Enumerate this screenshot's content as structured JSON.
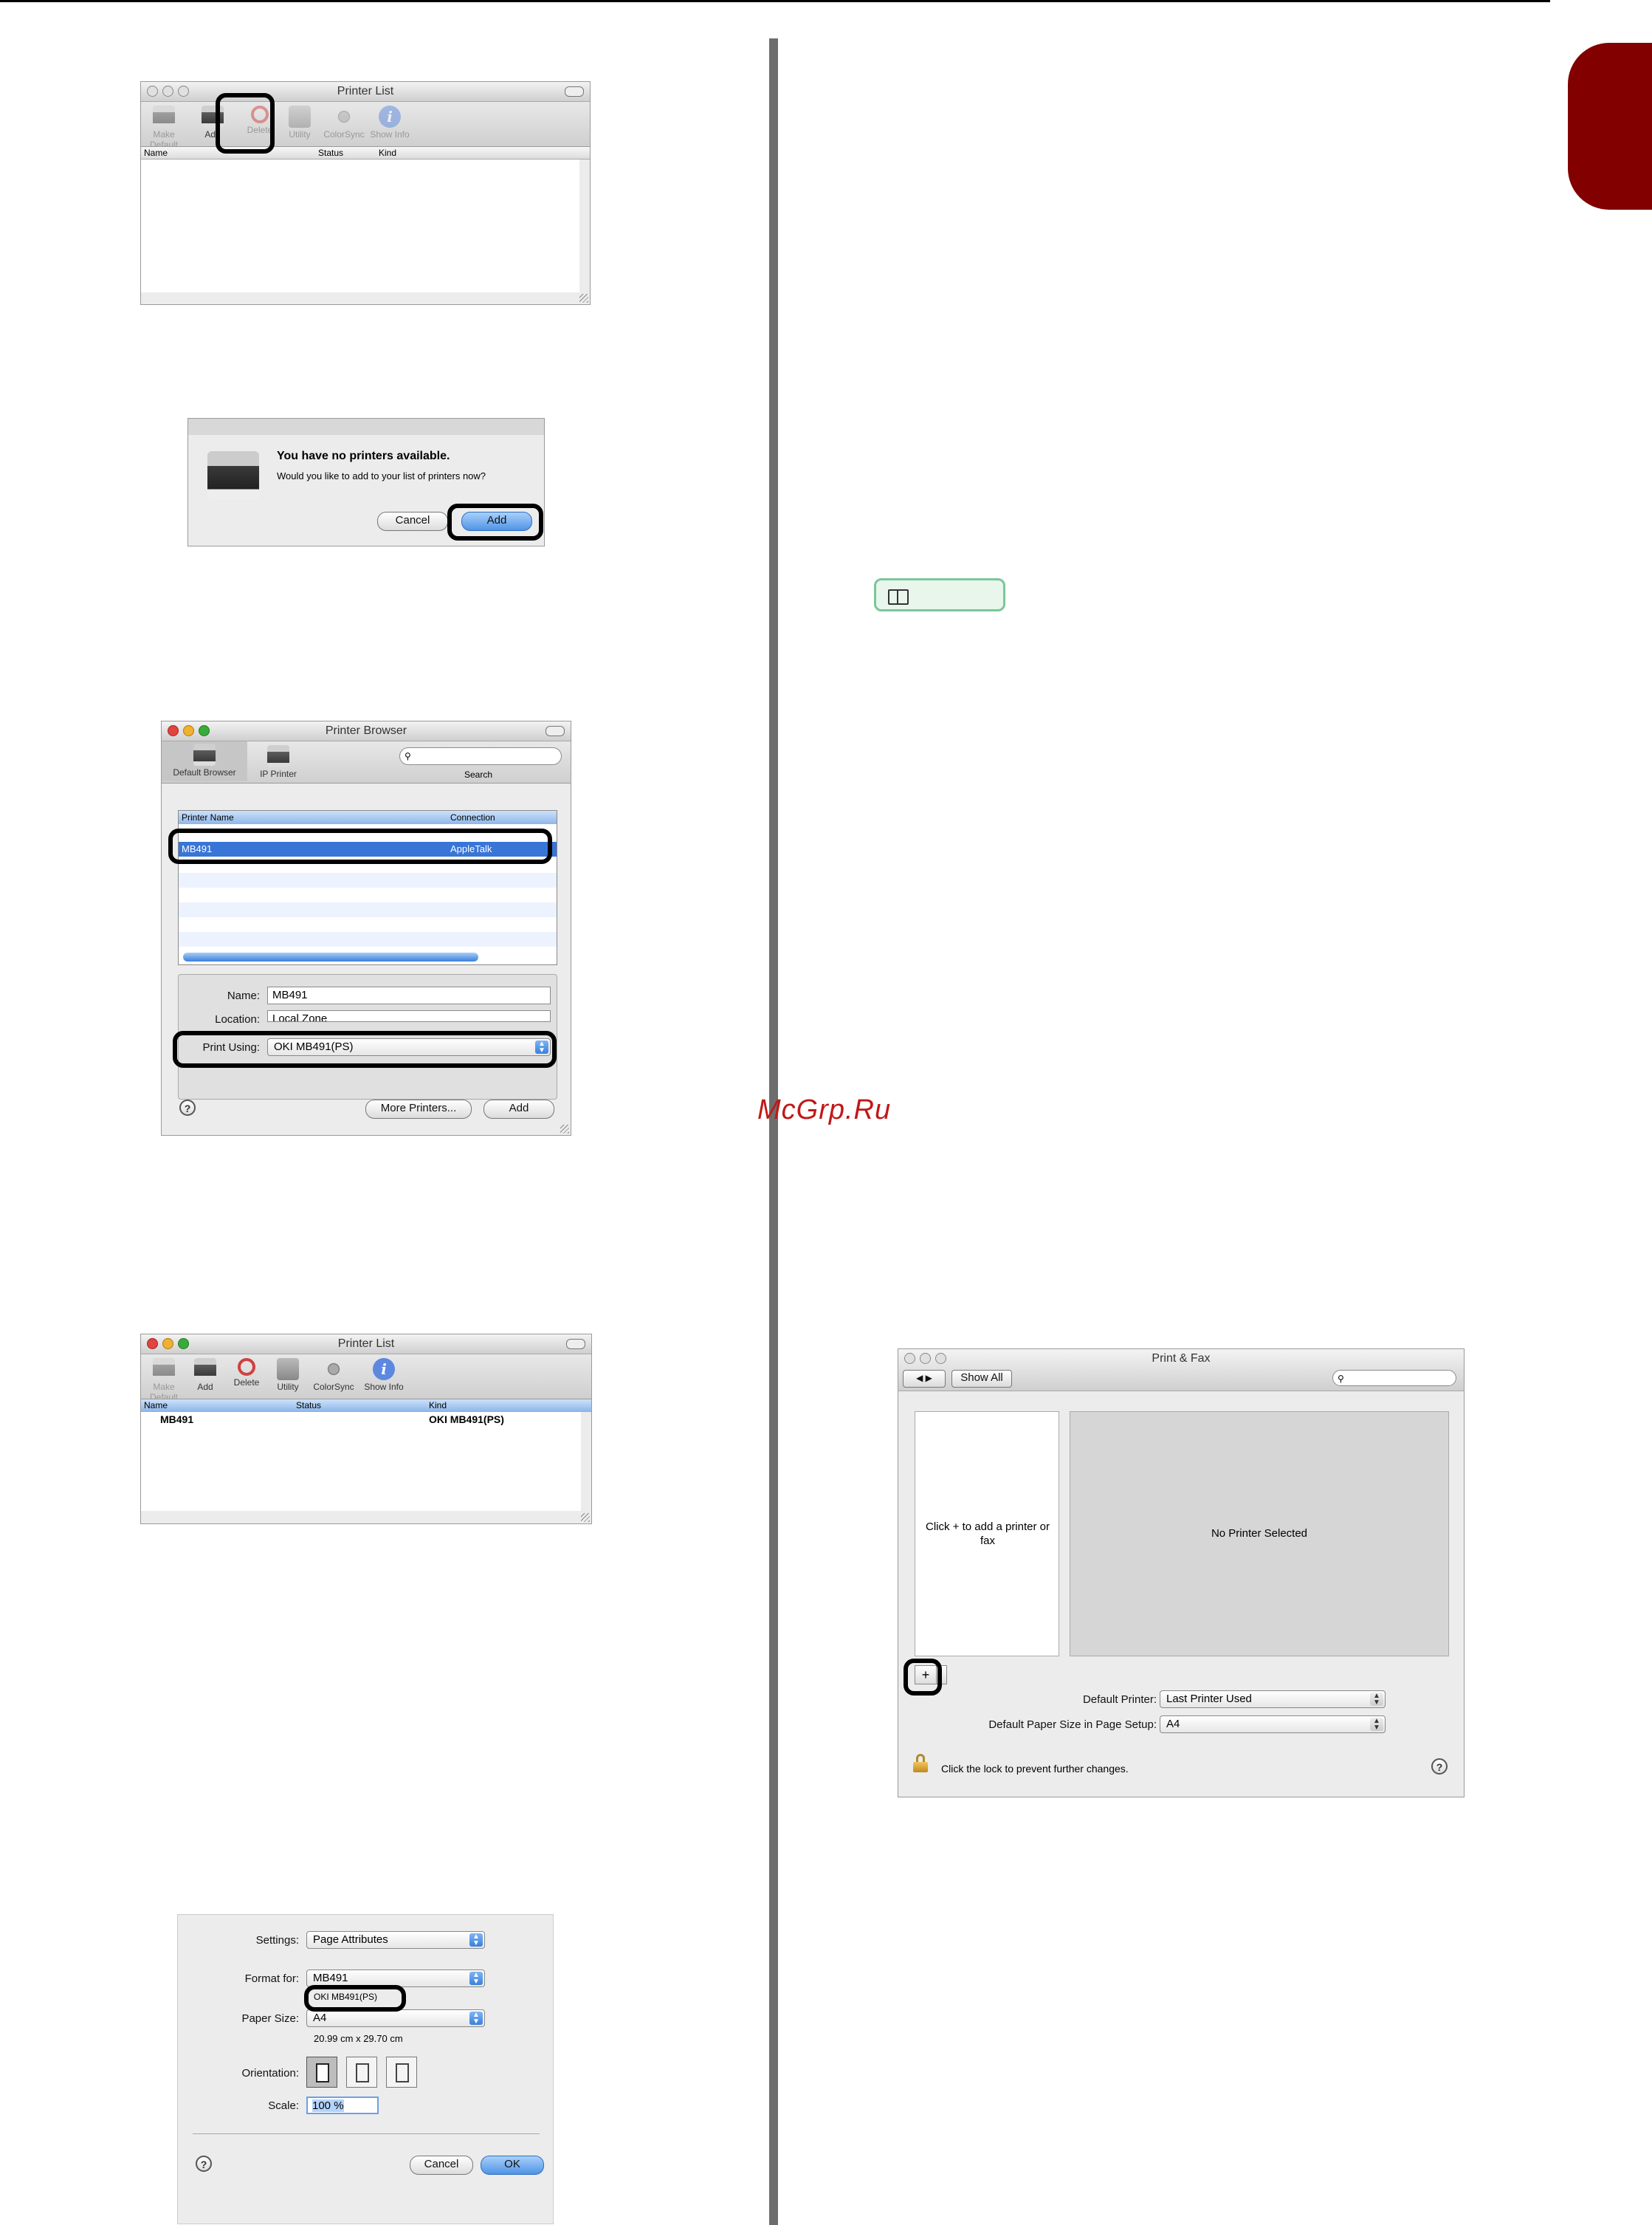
{
  "watermark": "McGrp.Ru",
  "printer_list_empty": {
    "title": "Printer List",
    "toolbar": [
      "Make Default",
      "Add",
      "Delete",
      "Utility",
      "ColorSync",
      "Show Info"
    ],
    "columns": [
      "Name",
      "Status",
      "Kind"
    ]
  },
  "no_printers_dialog": {
    "heading": "You have no printers available.",
    "message": "Would you like to add to your list of printers now?",
    "cancel": "Cancel",
    "add": "Add"
  },
  "printer_browser": {
    "title": "Printer Browser",
    "tabs": [
      "Default Browser",
      "IP Printer"
    ],
    "search_label": "Search",
    "columns": [
      "Printer Name",
      "Connection"
    ],
    "selected_row": {
      "name": "MB491",
      "connection": "AppleTalk"
    },
    "name_label": "Name:",
    "name_value": "MB491",
    "location_label": "Location:",
    "location_value": "Local Zone",
    "print_using_label": "Print Using:",
    "print_using_value": "OKI MB491(PS)",
    "more_printers": "More Printers...",
    "add": "Add",
    "help": "?"
  },
  "printer_list_added": {
    "title": "Printer List",
    "toolbar": [
      "Make Default",
      "Add",
      "Delete",
      "Utility",
      "ColorSync",
      "Show Info"
    ],
    "columns": [
      "Name",
      "Status",
      "Kind"
    ],
    "row": {
      "name": "MB491",
      "kind": "OKI MB491(PS)"
    }
  },
  "page_setup": {
    "settings_label": "Settings:",
    "settings_value": "Page Attributes",
    "format_label": "Format for:",
    "format_value": "MB491",
    "format_sub": "OKI MB491(PS)",
    "paper_label": "Paper Size:",
    "paper_value": "A4",
    "paper_sub": "20.99 cm x 29.70 cm",
    "orientation_label": "Orientation:",
    "scale_label": "Scale:",
    "scale_value": "100 %",
    "cancel": "Cancel",
    "ok": "OK",
    "help": "?"
  },
  "print_fax": {
    "title": "Print & Fax",
    "show_all": "Show All",
    "empty_list": "Click + to add a printer or fax",
    "no_selection": "No Printer Selected",
    "add_button": "+",
    "default_printer_label": "Default Printer:",
    "default_printer_value": "Last Printer Used",
    "paper_size_label": "Default Paper Size in Page Setup:",
    "paper_size_value": "A4",
    "lock_text": "Click the lock to prevent further changes.",
    "help": "?"
  }
}
